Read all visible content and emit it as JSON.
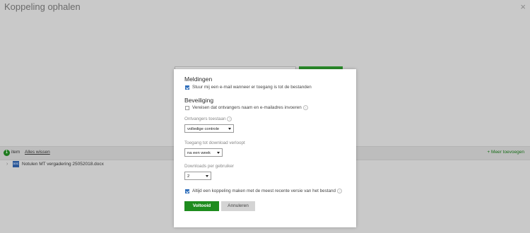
{
  "window": {
    "title": "Koppeling ophalen",
    "close_glyph": "×"
  },
  "items_bar": {
    "count": "1",
    "count_label": "item",
    "clear_all": "Alles wissen",
    "add_more": "+ Meer toevoegen"
  },
  "files": [
    {
      "chevron": "›",
      "icon_text": "DOC",
      "name": "Notulen MT vergadering 25052018.docx"
    }
  ],
  "dialog": {
    "notifications": {
      "heading": "Meldingen",
      "email_option": {
        "label": "Stuur mij een e-mail wanneer er toegang is tot de bestanden",
        "checked": true
      }
    },
    "security": {
      "heading": "Beveiliging",
      "require_name_option": {
        "label": "Vereisen dat ontvangers naam en e-mailadres invoeren",
        "checked": false
      }
    },
    "recipients_allowed": {
      "label": "Ontvangers toestaan",
      "value": "volledige controle"
    },
    "download_expiry": {
      "label": "Toegang tot download verloopt",
      "value": "na een week"
    },
    "downloads_per_user": {
      "label": "Downloads per gebruiker",
      "value": "2"
    },
    "latest_version_option": {
      "label": "Altijd een koppeling maken met de meest recente versie van het bestand",
      "checked": true
    },
    "buttons": {
      "done": "Voltooid",
      "cancel": "Annuleren"
    }
  },
  "colors": {
    "accent_green": "#1e8c1e",
    "checkbox_blue": "#2f6ebb",
    "overlay_gray": "#c9c9c9"
  }
}
